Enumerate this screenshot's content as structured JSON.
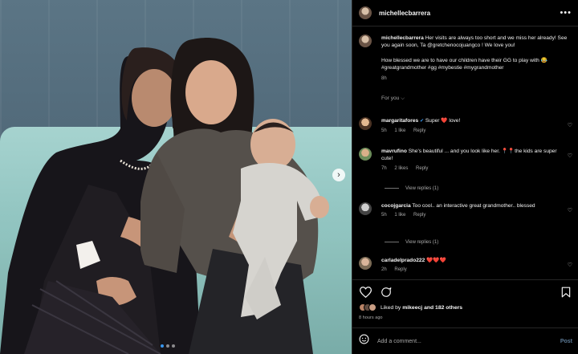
{
  "post": {
    "username": "michellecbarrera",
    "caption_user": "michellecbarrera",
    "caption_text": "Her visits are always too short and we miss her already! See you again soon, Ta @gretchenocojuangco ! We love you!",
    "caption_text2": "How blessed we are to have our children have their GG to play with 😂 #greatgrandmother #gg #mybestie #mygrandmother",
    "caption_time": "8h",
    "for_you": "For you ⌵"
  },
  "comments": [
    {
      "user": "margaritafores",
      "verified": true,
      "text": "Super ❤️ love!",
      "time": "5h",
      "likes": "1 like",
      "reply": "Reply",
      "view_replies": ""
    },
    {
      "user": "mavrufino",
      "verified": false,
      "text": "She's beautiful ... and you look like her. 📍📍the kids are super cute!",
      "time": "7h",
      "likes": "2 likes",
      "reply": "Reply",
      "view_replies": "View replies (1)"
    },
    {
      "user": "cocojgarcia",
      "verified": false,
      "text": "Too cool.. an interactive great grandmother.. blessed",
      "time": "5h",
      "likes": "1 like",
      "reply": "Reply",
      "view_replies": "View replies (1)"
    },
    {
      "user": "carladelprado222",
      "verified": false,
      "text": "❤️❤️❤️",
      "time": "2h",
      "likes": "",
      "reply": "Reply",
      "view_replies": ""
    }
  ],
  "likes": {
    "prefix": "Liked by",
    "user": "mikeecj",
    "rest": "and 182 others"
  },
  "time_ago": "8 hours ago",
  "add_comment": {
    "placeholder": "Add a comment...",
    "post_label": "Post"
  },
  "icons": {
    "more": "more-options-icon",
    "heart": "heart-icon",
    "comment": "comment-icon",
    "save": "bookmark-icon",
    "emoji": "emoji-icon",
    "next": "chevron-right-icon",
    "verified": "verified-badge-icon"
  },
  "colors": {
    "background": "#000000",
    "text_secondary": "#a8a8a8",
    "heart_red": "#ff3040",
    "verified_blue": "#3897f0",
    "post_disabled": "#5c7a96"
  }
}
